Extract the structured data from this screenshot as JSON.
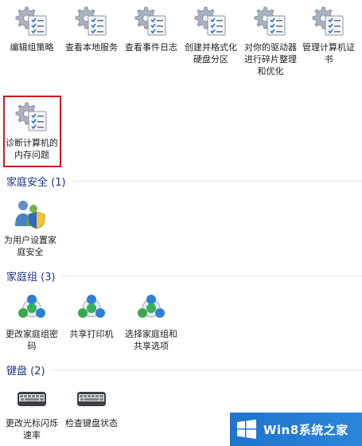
{
  "admin_tools": [
    {
      "label": "编辑组策略",
      "icon": "admin-tool-icon"
    },
    {
      "label": "查看本地服务",
      "icon": "admin-tool-icon"
    },
    {
      "label": "查看事件日志",
      "icon": "admin-tool-icon"
    },
    {
      "label": "创建并格式化硬盘分区",
      "icon": "admin-tool-icon"
    },
    {
      "label": "对你的驱动器进行碎片整理和优化",
      "icon": "admin-tool-icon"
    },
    {
      "label": "管理计算机证书",
      "icon": "admin-tool-icon"
    },
    {
      "label": "诊断计算机的内存问题",
      "icon": "admin-tool-icon"
    }
  ],
  "family_safety": {
    "header": "家庭安全 (1)",
    "items": [
      {
        "label": "为用户设置家庭安全",
        "icon": "family-safety-icon"
      }
    ]
  },
  "homegroup": {
    "header": "家庭组 (3)",
    "items": [
      {
        "label": "更改家庭组密码",
        "icon": "homegroup-icon"
      },
      {
        "label": "共享打印机",
        "icon": "homegroup-icon"
      },
      {
        "label": "选择家庭组和共享选项",
        "icon": "homegroup-icon"
      }
    ]
  },
  "keyboard": {
    "header": "键盘 (2)",
    "items": [
      {
        "label": "更改光标闪烁速率",
        "icon": "keyboard-icon"
      },
      {
        "label": "检查键盘状态",
        "icon": "keyboard-icon"
      }
    ]
  },
  "watermark": {
    "text": "Win8系统之家",
    "icon": "windows-logo-icon"
  },
  "colors": {
    "section_header": "#1e3287",
    "highlight": "#d0191c",
    "watermark_bg": "#2b86d9"
  }
}
